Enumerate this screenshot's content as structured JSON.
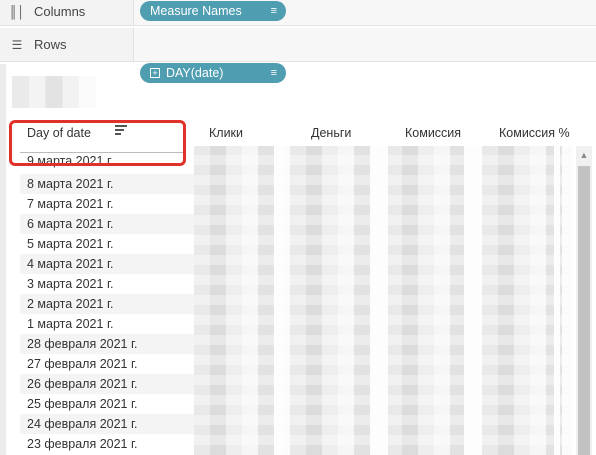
{
  "shelves": {
    "columns": {
      "label": "Columns",
      "icon": "columns-icon",
      "pill": "Measure Names"
    },
    "rows": {
      "label": "Rows",
      "icon": "rows-icon",
      "pill": "DAY(date)"
    }
  },
  "table": {
    "header": {
      "day": "Day of date",
      "clicks": "Клики",
      "money": "Деньги",
      "commission": "Комиссия",
      "commission_pct": "Комиссия %"
    },
    "rows": [
      "9 марта 2021 г.",
      "8 марта 2021 г.",
      "7 марта 2021 г.",
      "6 марта 2021 г.",
      "5 марта 2021 г.",
      "4 марта 2021 г.",
      "3 марта 2021 г.",
      "2 марта 2021 г.",
      "1 марта 2021 г.",
      "28 февраля 2021 г.",
      "27 февраля 2021 г.",
      "26 февраля 2021 г.",
      "25 февраля 2021 г.",
      "24 февраля 2021 г.",
      "23 февраля 2021 г."
    ]
  },
  "colors": {
    "pill": "#4f9db1",
    "highlight": "#e0322b"
  }
}
